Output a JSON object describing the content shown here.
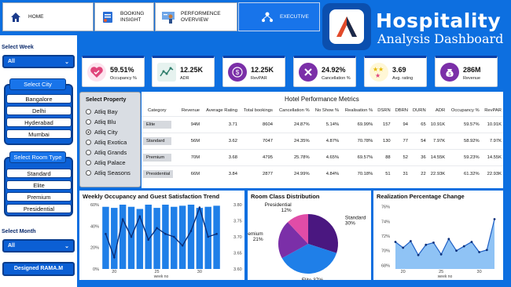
{
  "nav": {
    "home": "HOME",
    "booking": "BOOKING INSIGHT",
    "performance": "PERFORMENCE OVERVIEW",
    "executive": "EXECUTIVE"
  },
  "header": {
    "title": "Hospitality",
    "subtitle": "Analysis Dashboard"
  },
  "filters": {
    "week_label": "Select Week",
    "week_value": "All",
    "city_label": "Select City",
    "cities": [
      "Bangalore",
      "Delhi",
      "Hyderabad",
      "Mumbai"
    ],
    "room_label": "Select Room Type",
    "rooms": [
      "Standard",
      "Elite",
      "Premium",
      "Presidential"
    ],
    "month_label": "Select Month",
    "month_value": "All",
    "designed_by": "Designed RAMA.M"
  },
  "kpis": [
    {
      "value": "59.51%",
      "label": "Occupancy %",
      "icon": "heart-check-icon",
      "color": "#e0457b"
    },
    {
      "value": "12.25K",
      "label": "ADR",
      "icon": "line-chart-icon",
      "color": "#2e7d6b"
    },
    {
      "value": "12.25K",
      "label": "RevPAR",
      "icon": "money-circle-icon",
      "color": "#7b2fa8"
    },
    {
      "value": "24.92%",
      "label": "Cancellation %",
      "icon": "x-circle-icon",
      "color": "#7b2fa8"
    },
    {
      "value": "3.69",
      "label": "Avg. rating",
      "icon": "stars-icon",
      "color": "#e6b800"
    },
    {
      "value": "286M",
      "label": "Revenue",
      "icon": "money-bag-icon",
      "color": "#7b2fa8"
    }
  ],
  "property": {
    "label": "Select Property",
    "items": [
      "Atliq Bay",
      "Atliq Blu",
      "Atliq City",
      "Atliq Exotica",
      "Atliq Grands",
      "Atliq Palace",
      "Atliq Seasons"
    ],
    "selected": "Atliq City"
  },
  "metrics": {
    "title": "Hotel Performance Metrics",
    "columns": [
      "Category",
      "Revenue",
      "Average Rating",
      "Total bookings",
      "Cancellation %",
      "No Show %",
      "Realisation %",
      "DSRN",
      "DBRN",
      "DURN",
      "ADR",
      "Occupancy %",
      "RevPAR"
    ],
    "rows": [
      [
        "Elite",
        "94M",
        "3.71",
        "8604",
        "24.87%",
        "5.14%",
        "69.99%",
        "157",
        "94",
        "65",
        "10.91K",
        "59.57%",
        "10.91K"
      ],
      [
        "Standard",
        "56M",
        "3.62",
        "7047",
        "24.35%",
        "4.87%",
        "70.78%",
        "130",
        "77",
        "54",
        "7.97K",
        "58.92%",
        "7.97K"
      ],
      [
        "Premium",
        "70M",
        "3.68",
        "4795",
        "25.78%",
        "4.65%",
        "69.57%",
        "88",
        "52",
        "36",
        "14.55K",
        "59.23%",
        "14.55K"
      ],
      [
        "Presidential",
        "66M",
        "3.84",
        "2877",
        "24.99%",
        "4.84%",
        "70.18%",
        "51",
        "31",
        "22",
        "22.93K",
        "61.32%",
        "22.93K"
      ]
    ]
  },
  "charts": {
    "weekly_title": "Weekly Occupancy and Guest Satisfaction Trend",
    "room_title": "Room Class Distribution",
    "realization_title": "Realization Percentage Change"
  },
  "chart_data": [
    {
      "type": "bar",
      "title": "Weekly Occupancy and Guest Satisfaction Trend",
      "xlabel": "week no",
      "x": [
        19,
        20,
        21,
        22,
        23,
        24,
        25,
        26,
        27,
        28,
        29,
        30,
        31,
        32
      ],
      "x_ticks": [
        "20",
        "25",
        "30"
      ],
      "y_ticks_left": [
        "60%",
        "40%",
        "20%",
        "0%"
      ],
      "y_ticks_right": [
        "3.80",
        "3.75",
        "3.70",
        "3.65",
        "3.60"
      ],
      "ylim_left": [
        0,
        60
      ],
      "ylim_right": [
        3.58,
        3.8
      ],
      "series": [
        {
          "type": "bar",
          "axis": "left",
          "values": [
            58,
            57,
            60,
            58,
            56,
            60,
            57,
            60,
            58,
            59,
            60,
            57,
            58,
            59
          ]
        },
        {
          "type": "line",
          "axis": "right",
          "values": [
            3.7,
            3.62,
            3.75,
            3.69,
            3.76,
            3.68,
            3.72,
            3.7,
            3.69,
            3.66,
            3.71,
            3.79,
            3.69,
            3.7
          ]
        }
      ]
    },
    {
      "type": "pie",
      "title": "Room Class Distribution",
      "categories": [
        "Standard",
        "Elite",
        "Premium",
        "Presidential"
      ],
      "values": [
        30,
        37,
        21,
        12
      ],
      "labels": [
        "Standard\n30%",
        "Elite 37%",
        "Premium\n21%",
        "Presidential\n12%"
      ],
      "colors": [
        "#4a1780",
        "#1f7fe8",
        "#7b2fa8",
        "#e04ca7"
      ]
    },
    {
      "type": "area",
      "title": "Realization Percentage Change",
      "xlabel": "week no",
      "x": [
        19,
        20,
        21,
        22,
        23,
        24,
        25,
        26,
        27,
        28,
        29,
        30,
        31,
        32
      ],
      "x_ticks": [
        "20",
        "25",
        "30"
      ],
      "y_ticks": [
        "76%",
        "74%",
        "72%",
        "70%",
        "68%"
      ],
      "ylim": [
        67.5,
        76.5
      ],
      "values": [
        71.2,
        70.4,
        71.3,
        69.4,
        70.8,
        71.1,
        69.5,
        71.6,
        70.0,
        70.6,
        71.2,
        69.8,
        70.1,
        74.3
      ]
    }
  ]
}
